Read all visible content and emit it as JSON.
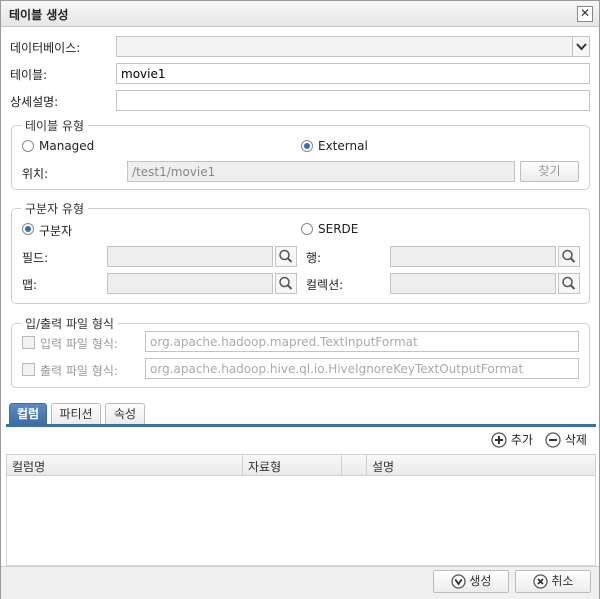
{
  "window": {
    "title": "테이블 생성",
    "close_glyph": "✕"
  },
  "form": {
    "database_label": "데이터베이스:",
    "database_value": "",
    "table_label": "테이블:",
    "table_value": "movie1",
    "description_label": "상세설명:",
    "description_value": ""
  },
  "table_type": {
    "legend": "테이블 유형",
    "managed_label": "Managed",
    "external_label": "External",
    "selected": "External",
    "location_label": "위치:",
    "location_value": "/test1/movie1",
    "browse_label": "찾기"
  },
  "delimiter_type": {
    "legend": "구분자 유형",
    "delimiter_label": "구분자",
    "serde_label": "SERDE",
    "selected": "구분자",
    "field_label": "필드:",
    "row_label": "행:",
    "map_label": "맵:",
    "collection_label": "컬렉션:"
  },
  "io_format": {
    "legend": "입/출력 파일 형식",
    "input_label": "입력 파일 형식:",
    "input_value": "org.apache.hadoop.mapred.TextInputFormat",
    "output_label": "출력 파일 형식:",
    "output_value": "org.apache.hadoop.hive.ql.io.HiveIgnoreKeyTextOutputFormat"
  },
  "tabs": [
    {
      "label": "컬럼",
      "active": true
    },
    {
      "label": "파티션",
      "active": false
    },
    {
      "label": "속성",
      "active": false
    }
  ],
  "column_toolbar": {
    "add_label": "추가",
    "delete_label": "삭제"
  },
  "column_table": {
    "headers": [
      "컬럼명",
      "자료형",
      "",
      "설명"
    ],
    "rows": []
  },
  "footer": {
    "create_label": "생성",
    "cancel_label": "취소"
  },
  "colors": {
    "accent": "#3d6ea8",
    "radio_dot": "#2f6fb5"
  }
}
